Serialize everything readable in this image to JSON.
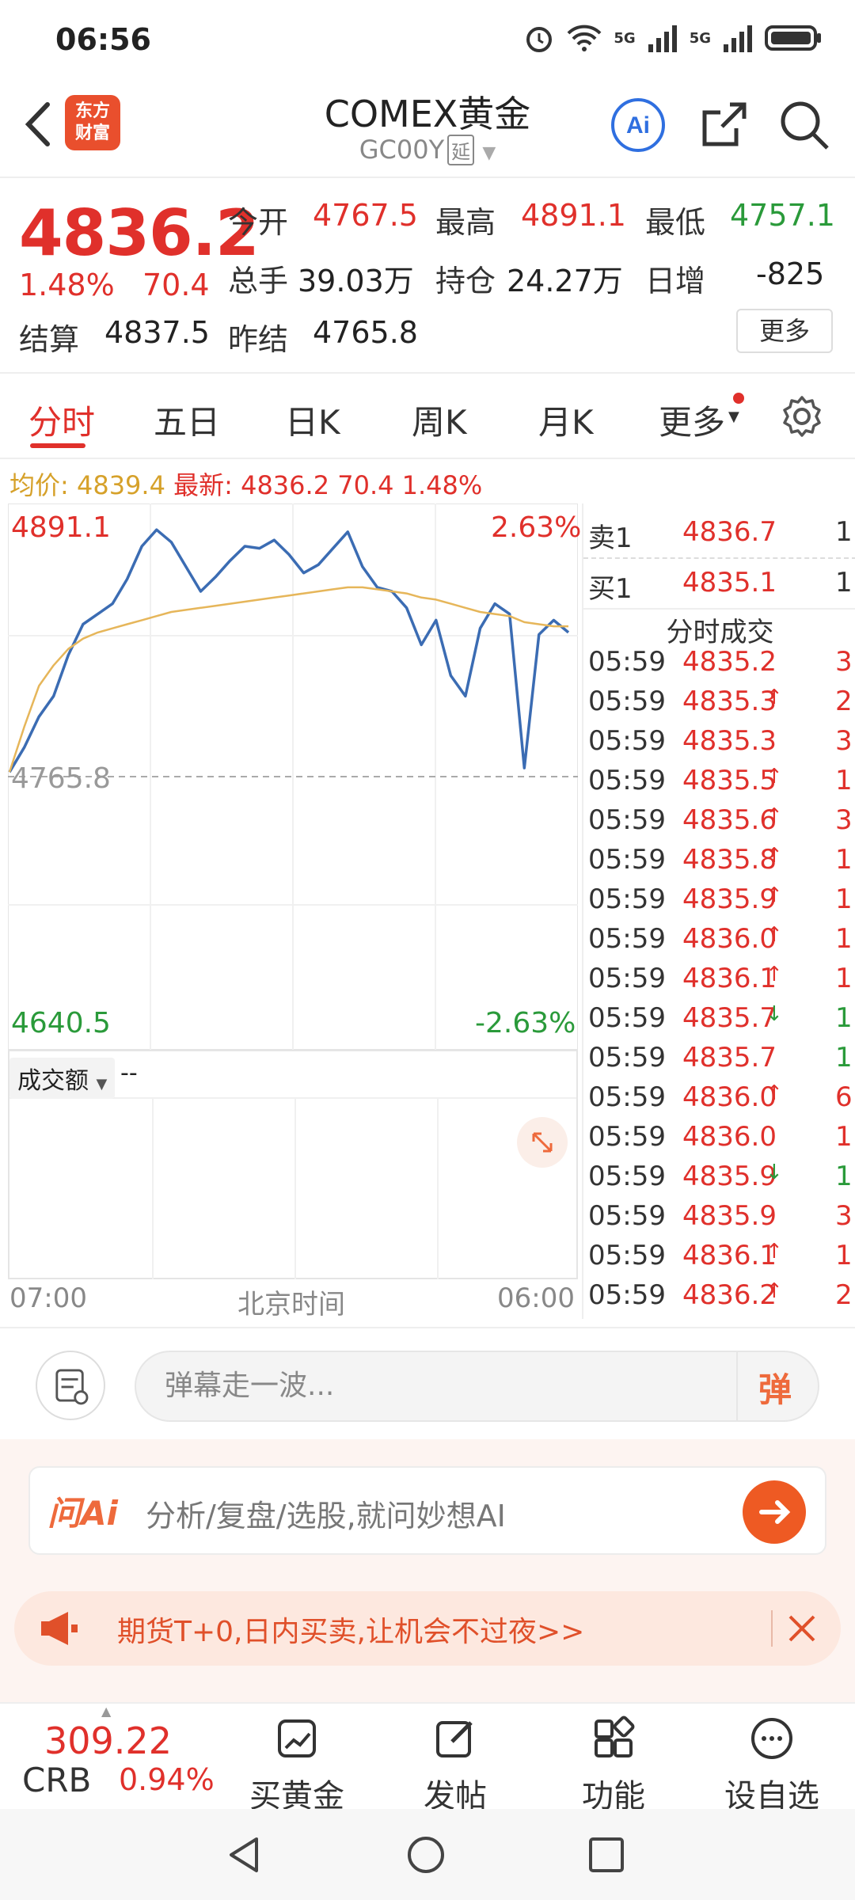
{
  "status_bar": {
    "time": "06:56",
    "net1": "5G",
    "net2": "5G"
  },
  "header": {
    "logo_line1": "东方",
    "logo_line2": "财富",
    "title": "COMEX黄金",
    "subtitle": "GC00Y",
    "delay_tag": "延"
  },
  "quote": {
    "price": "4836.2",
    "change_pct": "1.48%",
    "change_abs": "70.4",
    "open_label": "今开",
    "open_value": "4767.5",
    "high_label": "最高",
    "high_value": "4891.1",
    "low_label": "最低",
    "low_value": "4757.1",
    "volume_label": "总手",
    "volume_value": "39.03万",
    "oi_label": "持仓",
    "oi_value": "24.27万",
    "daily_inc_label": "日增",
    "daily_inc_value": "-825",
    "settle_label": "结算",
    "settle_value": "4837.5",
    "prev_settle_label": "昨结",
    "prev_settle_value": "4765.8",
    "more_button": "更多"
  },
  "tabs": [
    "分时",
    "五日",
    "日K",
    "周K",
    "月K",
    "更多"
  ],
  "info_line": {
    "avg_label": "均价:",
    "avg_value": "4839.4",
    "latest_label": "最新:",
    "latest_value": "4836.2",
    "latest_change": "70.4",
    "latest_pct": "1.48%"
  },
  "chart_data": {
    "type": "line",
    "y_top_label": "4891.1",
    "y_top_pct": "2.63%",
    "y_bottom_label": "4640.5",
    "y_bottom_pct": "-2.63%",
    "baseline_label": "4765.8",
    "ylim": [
      4640.5,
      4891.1
    ],
    "series": [
      {
        "values": [
          4768,
          4780,
          4795,
          4805,
          4825,
          4840,
          4845,
          4850,
          4862,
          4878,
          4886,
          4880,
          4868,
          4856,
          4863,
          4871,
          4878,
          4877,
          4881,
          4874,
          4865,
          4869,
          4877,
          4885,
          4868,
          4858,
          4856,
          4848,
          4830,
          4842,
          4815,
          4805,
          4838,
          4850,
          4845,
          4770,
          4835,
          4842,
          4836
        ]
      },
      {
        "values": [
          4768,
          4790,
          4810,
          4820,
          4828,
          4833,
          4836,
          4838,
          4840,
          4842,
          4844,
          4846,
          4847,
          4848,
          4849,
          4850,
          4851,
          4852,
          4853,
          4854,
          4855,
          4856,
          4857,
          4858,
          4858,
          4857,
          4856,
          4855,
          4853,
          4852,
          4850,
          4848,
          4846,
          4845,
          4844,
          4841,
          4840,
          4839,
          4839
        ]
      }
    ]
  },
  "volume_label": "成交额",
  "volume_value": "--",
  "time_axis": {
    "start": "07:00",
    "middle": "北京时间",
    "end": "06:00"
  },
  "order_book": [
    {
      "side": "卖1",
      "price": "4836.7",
      "qty": "1"
    },
    {
      "side": "买1",
      "price": "4835.1",
      "qty": "1"
    }
  ],
  "trades_title": "分时成交",
  "trades": [
    {
      "time": "05:59",
      "price": "4835.2",
      "arrow": "",
      "qty": "3",
      "dir": "red"
    },
    {
      "time": "05:59",
      "price": "4835.3",
      "arrow": "↑",
      "qty": "2",
      "dir": "red"
    },
    {
      "time": "05:59",
      "price": "4835.3",
      "arrow": "",
      "qty": "3",
      "dir": "red"
    },
    {
      "time": "05:59",
      "price": "4835.5",
      "arrow": "↑",
      "qty": "1",
      "dir": "red"
    },
    {
      "time": "05:59",
      "price": "4835.6",
      "arrow": "↑",
      "qty": "3",
      "dir": "red"
    },
    {
      "time": "05:59",
      "price": "4835.8",
      "arrow": "↑",
      "qty": "1",
      "dir": "red"
    },
    {
      "time": "05:59",
      "price": "4835.9",
      "arrow": "↑",
      "qty": "1",
      "dir": "red"
    },
    {
      "time": "05:59",
      "price": "4836.0",
      "arrow": "↑",
      "qty": "1",
      "dir": "red"
    },
    {
      "time": "05:59",
      "price": "4836.1",
      "arrow": "↑",
      "qty": "1",
      "dir": "red"
    },
    {
      "time": "05:59",
      "price": "4835.7",
      "arrow": "↓",
      "qty": "1",
      "dir": "green"
    },
    {
      "time": "05:59",
      "price": "4835.7",
      "arrow": "",
      "qty": "1",
      "dir": "green"
    },
    {
      "time": "05:59",
      "price": "4836.0",
      "arrow": "↑",
      "qty": "6",
      "dir": "red"
    },
    {
      "time": "05:59",
      "price": "4836.0",
      "arrow": "",
      "qty": "1",
      "dir": "red"
    },
    {
      "time": "05:59",
      "price": "4835.9",
      "arrow": "↓",
      "qty": "1",
      "dir": "green"
    },
    {
      "time": "05:59",
      "price": "4835.9",
      "arrow": "",
      "qty": "3",
      "dir": "red"
    },
    {
      "time": "05:59",
      "price": "4836.1",
      "arrow": "↑",
      "qty": "1",
      "dir": "red"
    },
    {
      "time": "05:59",
      "price": "4836.2",
      "arrow": "↑",
      "qty": "2",
      "dir": "red"
    }
  ],
  "comment": {
    "placeholder": "弹幕走一波...",
    "danmu_icon": "弹"
  },
  "ai": {
    "brand": "问Ai",
    "prompt": "分析/复盘/选股,就问妙想AI"
  },
  "promo": {
    "text": "期货T+0,日内买卖,让机会不过夜>>"
  },
  "bottom_bar": {
    "crb_value": "309.22",
    "crb_name": "CRB",
    "crb_pct": "0.94%",
    "nav": [
      "买黄金",
      "发帖",
      "功能",
      "设自选"
    ]
  },
  "colors": {
    "up": "#e0302b",
    "down": "#2a9a3a",
    "line": "#3b6cb3",
    "avg": "#e6b65a",
    "accent": "#ee5a23"
  }
}
